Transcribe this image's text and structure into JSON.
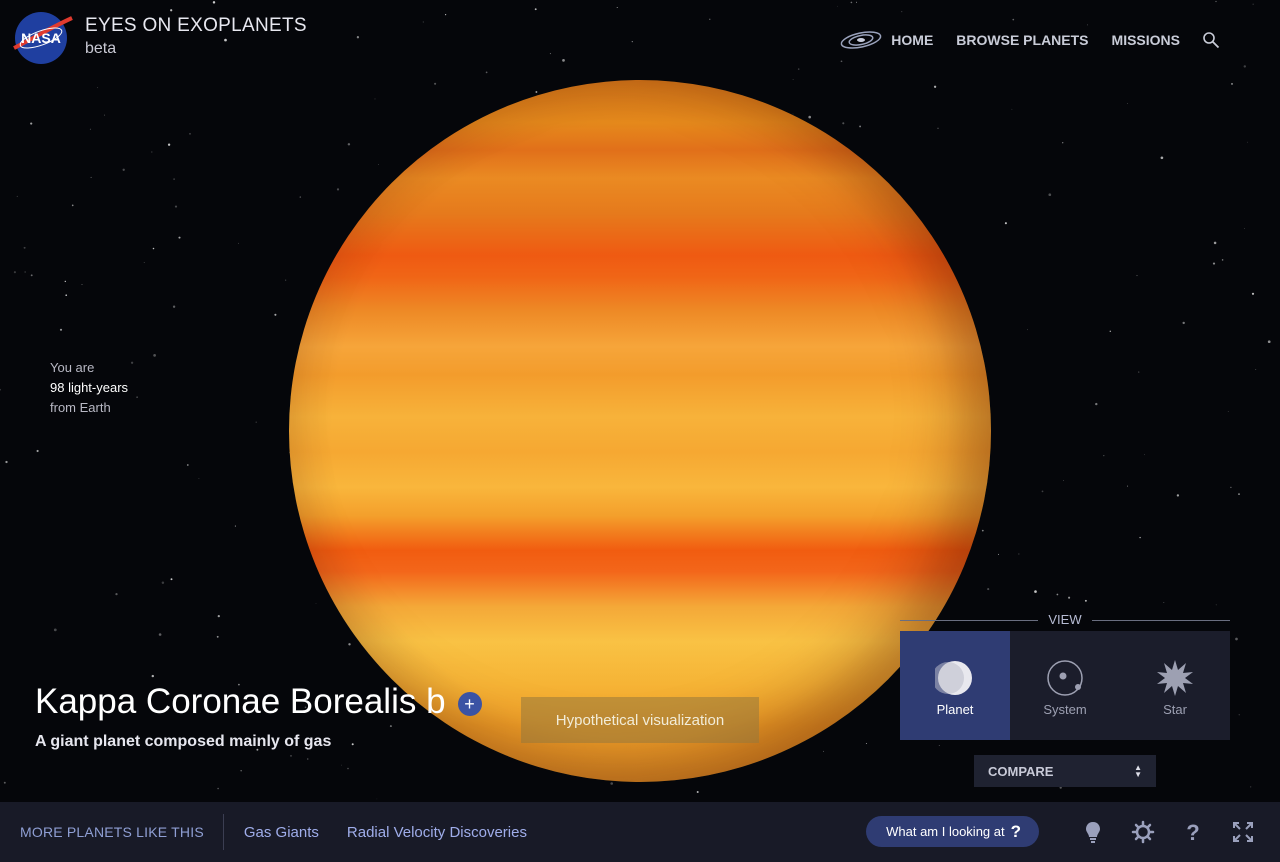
{
  "header": {
    "logo_text": "NASA",
    "app_title": "EYES ON EXOPLANETS",
    "app_subtitle": "beta",
    "nav": {
      "home": "HOME",
      "browse": "BROWSE PLANETS",
      "missions": "MISSIONS"
    },
    "icons": {
      "galaxy": "galaxy-icon",
      "search": "search-icon"
    }
  },
  "distance": {
    "prefix": "You are",
    "value": "98 light-years",
    "suffix": "from Earth"
  },
  "planet": {
    "name": "Kappa Coronae Borealis b",
    "add_symbol": "+",
    "description": "A giant planet composed mainly of gas",
    "visualization_note": "Hypothetical visualization"
  },
  "view": {
    "label": "VIEW",
    "options": [
      {
        "label": "Planet",
        "icon": "planet-icon",
        "active": true
      },
      {
        "label": "System",
        "icon": "system-icon",
        "active": false
      },
      {
        "label": "Star",
        "icon": "star-icon",
        "active": false
      }
    ]
  },
  "compare": {
    "label": "COMPARE"
  },
  "footer": {
    "more_label": "MORE PLANETS LIKE THIS",
    "categories": [
      "Gas Giants",
      "Radial Velocity Discoveries"
    ],
    "what_button": "What am I looking at",
    "what_symbol": "?",
    "icons": [
      "lightbulb-icon",
      "settings-icon",
      "help-icon",
      "fullscreen-icon"
    ]
  },
  "colors": {
    "accent": "#2f3c73",
    "link": "#9fadea",
    "footer_bg": "#181a27"
  }
}
